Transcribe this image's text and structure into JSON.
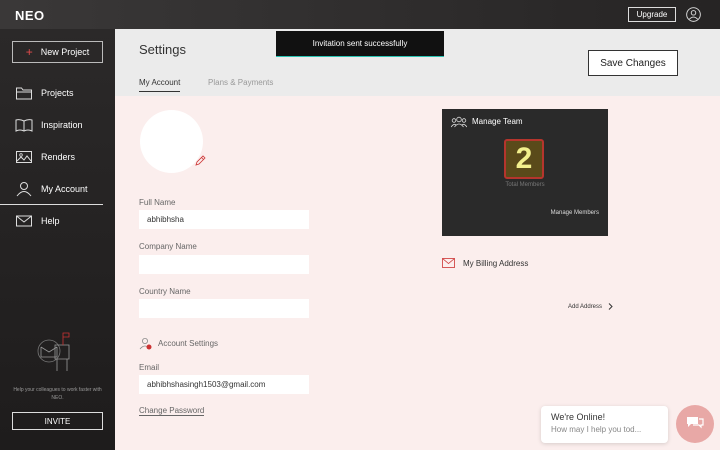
{
  "topbar": {
    "brand": "NEO",
    "upgrade_label": "Upgrade"
  },
  "sidebar": {
    "new_project_label": "New Project",
    "items": [
      {
        "label": "Projects",
        "icon": "folder-icon"
      },
      {
        "label": "Inspiration",
        "icon": "book-icon"
      },
      {
        "label": "Renders",
        "icon": "image-icon"
      },
      {
        "label": "My Account",
        "icon": "user-icon"
      },
      {
        "label": "Help",
        "icon": "mail-icon"
      }
    ],
    "help_text": "Help your colleagues to work faster with NEO.",
    "invite_label": "INVITE"
  },
  "header": {
    "title": "Settings",
    "toast": "Invitation sent successfully",
    "save_label": "Save Changes",
    "tabs": [
      {
        "label": "My Account"
      },
      {
        "label": "Plans & Payments"
      }
    ]
  },
  "form": {
    "full_name_label": "Full Name",
    "full_name_value": "abhibhsha",
    "company_label": "Company Name",
    "company_value": "",
    "country_label": "Country Name",
    "country_value": "",
    "account_settings_label": "Account Settings",
    "email_label": "Email",
    "email_value": "abhibhshasingh1503@gmail.com",
    "change_password_label": "Change Password"
  },
  "team": {
    "title": "Manage Team",
    "count": "2",
    "count_label": "Total Members",
    "manage_label": "Manage Members"
  },
  "billing": {
    "title": "My Billing Address",
    "add_label": "Add Address"
  },
  "chat": {
    "title": "We're Online!",
    "subtitle": "How may I help you tod..."
  }
}
